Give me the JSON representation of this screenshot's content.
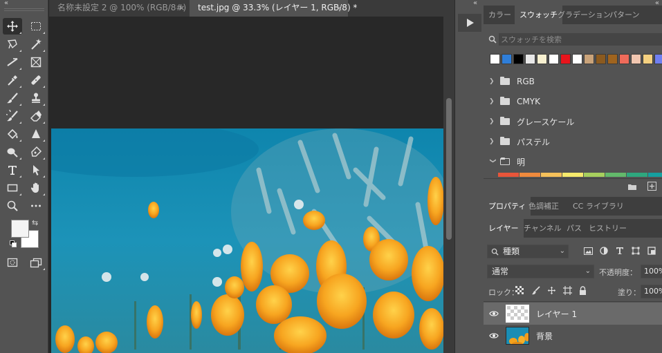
{
  "tabs": [
    {
      "label": "名称未設定 2 @ 100% (RGB/8#)",
      "close": "×",
      "active": false
    },
    {
      "label": "test.jpg @ 33.3% (レイヤー 1, RGB/8) *",
      "close": "×",
      "active": true
    }
  ],
  "toolbar": {
    "collapse_glyph": "«",
    "tools": [
      "move-tool-icon",
      "marquee-tool-icon",
      "lasso-tool-icon",
      "magic-wand-tool-icon",
      "crop-tool-icon",
      "frame-tool-icon",
      "eyedropper-tool-icon",
      "healing-brush-tool-icon",
      "brush-tool-icon",
      "clone-stamp-tool-icon",
      "history-brush-tool-icon",
      "eraser-tool-icon",
      "paint-bucket-tool-icon",
      "sharpen-tool-icon",
      "dodge-tool-icon",
      "pen-tool-icon",
      "type-tool-icon",
      "path-selection-tool-icon",
      "rectangle-tool-icon",
      "hand-tool-icon",
      "zoom-tool-icon",
      "more-tools-icon"
    ],
    "foreground_color": "#f4f4f4",
    "background_color": "#ffffff"
  },
  "top_panel": {
    "collapse_glyph": "«",
    "tabs": [
      "カラー",
      "スウォッチ",
      "グラデーション",
      "パターン"
    ],
    "active_tab": "スウォッチ",
    "search_placeholder": "スウォッチを検索",
    "recent_swatches": [
      "#ffffff",
      "#2f7ed8",
      "#000000",
      "#e8e8e8",
      "#f7f0d0",
      "#ffffff",
      "#e8141c",
      "#ffffff",
      "#c9a37a",
      "#8b5a1f",
      "#a0641e",
      "#ef6b5a",
      "#f1c6b0",
      "#f4d080",
      "#6f7ff0"
    ],
    "groups": [
      {
        "label": "RGB",
        "expanded": false
      },
      {
        "label": "CMYK",
        "expanded": false
      },
      {
        "label": "グレースケール",
        "expanded": false
      },
      {
        "label": "パステル",
        "expanded": false
      },
      {
        "label": "明",
        "expanded": true
      }
    ],
    "strip_colors": [
      "#e8553a",
      "#ef8a3d",
      "#f5c05a",
      "#f6ea6c",
      "#a7cf5e",
      "#63b96b",
      "#2ea77e",
      "#15a0a0"
    ]
  },
  "middle_panel": {
    "tabs": [
      "プロパティ",
      "色調補正",
      "CC ライブラリ"
    ],
    "active_tab": "プロパティ"
  },
  "layers_panel": {
    "tabs": [
      "レイヤー",
      "チャンネル",
      "パス",
      "ヒストリー"
    ],
    "active_tab": "レイヤー",
    "filter_label": "種類",
    "blend_mode": "通常",
    "opacity_label": "不透明度：",
    "opacity_value": "100%",
    "lock_label": "ロック：",
    "fill_label": "塗り：",
    "fill_value": "100%",
    "layers": [
      {
        "name": "レイヤー 1",
        "selected": true,
        "visible": true
      },
      {
        "name": "背景",
        "selected": false,
        "visible": true
      }
    ]
  }
}
